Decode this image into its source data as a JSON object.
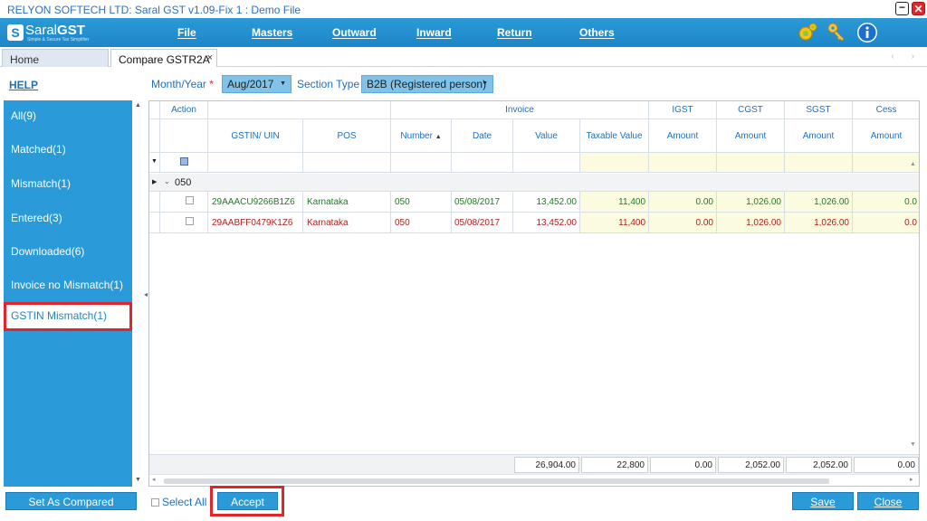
{
  "window": {
    "title": "RELYON SOFTECH LTD: Saral GST v1.09-Fix 1 : Demo File",
    "min_glyph": "−",
    "close_glyph": "✕"
  },
  "logo": {
    "mark": "S",
    "brand_light": "Saral",
    "brand_bold": "GST",
    "tagline": "Simple & Secure Tax Simplifier"
  },
  "menu": [
    "File",
    "Masters",
    "Outward",
    "Inward",
    "Return",
    "Others"
  ],
  "toolbar_icons": [
    "settings-gear-icon",
    "key-icon",
    "info-icon"
  ],
  "tabs": {
    "home": "Home",
    "active": "Compare GSTR2A",
    "close_glyph": "×",
    "nav_glyphs": "‹ ›"
  },
  "help": "HELP",
  "sidebar": {
    "items": [
      "All(9)",
      "Matched(1)",
      "Mismatch(1)",
      "Entered(3)",
      "Downloaded(6)",
      "Invoice no Mismatch(1)",
      "GSTIN Mismatch(1)"
    ],
    "selected": "GSTIN Mismatch(1)"
  },
  "filters": {
    "month_label": "Month/Year",
    "required_mark": "*",
    "month_value": "Aug/2017",
    "section_label": "Section Type",
    "section_value": "B2B (Registered person)"
  },
  "grid": {
    "band_headers": {
      "action": "Action",
      "invoice": "Invoice",
      "igst": "IGST",
      "cgst": "CGST",
      "sgst": "SGST",
      "cess": "Cess"
    },
    "columns": {
      "gstin": "GSTIN/ UIN",
      "pos": "POS",
      "number": "Number",
      "date": "Date",
      "value": "Value",
      "taxable": "Taxable Value",
      "igst_amt": "Amount",
      "cgst_amt": "Amount",
      "sgst_amt": "Amount",
      "cess_amt": "Amount"
    },
    "group_label": "050",
    "rows": [
      {
        "gstin": "29AAACU9266B1Z6",
        "pos": "Karnataka",
        "number": "050",
        "date": "05/08/2017",
        "value": "13,452.00",
        "taxable": "11,400",
        "igst": "0.00",
        "cgst": "1,026.00",
        "sgst": "1,026.00",
        "cess": "0.0",
        "color": "#1f7a1f"
      },
      {
        "gstin": "29AABFF0479K1Z6",
        "pos": "Karnataka",
        "number": "050",
        "date": "05/08/2017",
        "value": "13,452.00",
        "taxable": "11,400",
        "igst": "0.00",
        "cgst": "1,026.00",
        "sgst": "1,026.00",
        "cess": "0.0",
        "color": "#b02020"
      }
    ],
    "totals": {
      "value": "26,904.00",
      "taxable": "22,800",
      "igst": "0.00",
      "cgst": "2,052.00",
      "sgst": "2,052.00",
      "cess": "0.00"
    }
  },
  "bottom": {
    "set_as_compared": "Set As Compared",
    "select_all": "Select All",
    "accept": "Accept",
    "save": "Save",
    "close": "Close"
  },
  "colors": {
    "accent": "#2a9ad8",
    "highlight": "#e0262b",
    "matched_text": "#1f7a1f",
    "mismatch_text": "#b02020"
  }
}
